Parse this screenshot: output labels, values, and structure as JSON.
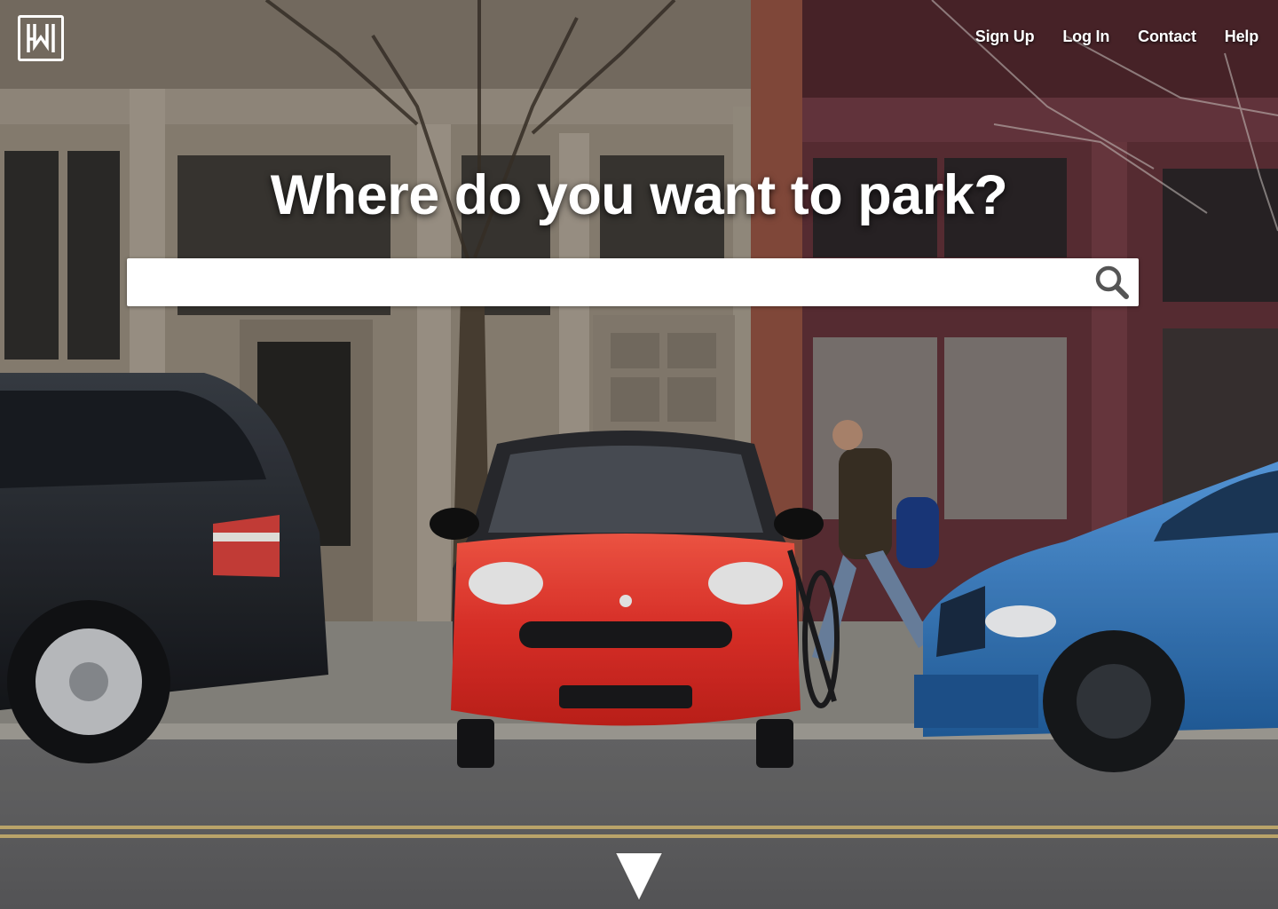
{
  "brand": {
    "logo_icon": "hm-monogram-icon"
  },
  "nav": {
    "items": [
      {
        "label": "Sign Up"
      },
      {
        "label": "Log In"
      },
      {
        "label": "Contact"
      },
      {
        "label": "Help"
      }
    ]
  },
  "hero": {
    "headline": "Where do you want to park?",
    "search": {
      "value": "",
      "placeholder": "",
      "icon": "search-icon"
    },
    "scroll_icon": "arrow-down-icon",
    "background_description_icon": "street-parking-photo"
  },
  "colors": {
    "text": "#ffffff",
    "search_bg": "#ffffff",
    "search_icon": "#555555",
    "car_red": "#e8322a",
    "car_blue": "#2c6fb8",
    "car_black": "#1e2126"
  }
}
